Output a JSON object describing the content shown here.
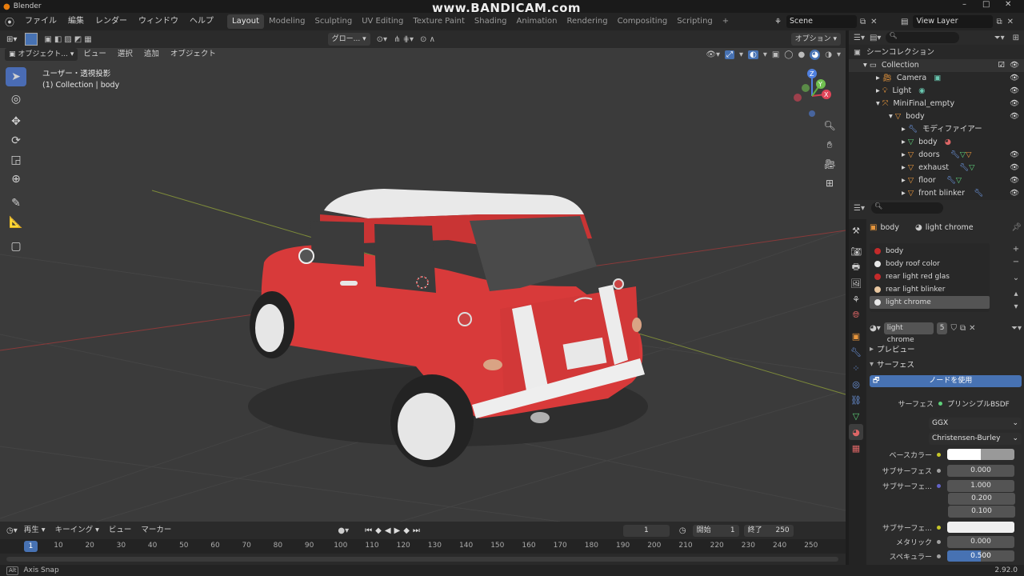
{
  "app_title": "Blender",
  "watermark": "www.BANDICAM.com",
  "menu": [
    "ファイル",
    "編集",
    "レンダー",
    "ウィンドウ",
    "ヘルプ"
  ],
  "workspaces": [
    "Layout",
    "Modeling",
    "Sculpting",
    "UV Editing",
    "Texture Paint",
    "Shading",
    "Animation",
    "Rendering",
    "Compositing",
    "Scripting"
  ],
  "active_workspace": "Layout",
  "scene": "Scene",
  "view_layer": "View Layer",
  "viewport": {
    "orientation": "グロー...",
    "options": "オプション",
    "mode": "オブジェクト...",
    "menus": [
      "ビュー",
      "選択",
      "追加",
      "オブジェクト"
    ],
    "info_line1": "ユーザー・透視投影",
    "info_line2": "(1) Collection | body"
  },
  "outliner": {
    "title": "シーンコレクション",
    "rows": [
      {
        "label": "Collection",
        "indent": 1
      },
      {
        "label": "Camera",
        "indent": 2
      },
      {
        "label": "Light",
        "indent": 2
      },
      {
        "label": "MiniFinal_empty",
        "indent": 2
      },
      {
        "label": "body",
        "indent": 3
      },
      {
        "label": "モディファイアー",
        "indent": 4
      },
      {
        "label": "body",
        "indent": 4
      },
      {
        "label": "doors",
        "indent": 4
      },
      {
        "label": "exhaust",
        "indent": 4
      },
      {
        "label": "floor",
        "indent": 4
      },
      {
        "label": "front blinker",
        "indent": 4
      }
    ]
  },
  "properties": {
    "breadcrumb_object": "body",
    "breadcrumb_material": "light chrome",
    "slots": [
      {
        "name": "body",
        "color": "#c42a2a"
      },
      {
        "name": "body roof color",
        "color": "#e8e8e8"
      },
      {
        "name": "rear light red glas",
        "color": "#c42a2a"
      },
      {
        "name": "rear light blinker",
        "color": "#e8c7a0"
      },
      {
        "name": "light chrome",
        "color": "#e8e8e8"
      }
    ],
    "active_slot": 4,
    "material_name": "light chrome",
    "user_count": "5",
    "preview_label": "プレビュー",
    "surface_label": "サーフェス",
    "use_nodes": "ノードを使用",
    "surface_row_label": "サーフェス",
    "shader": "プリンシプルBSDF",
    "distribution": "GGX",
    "subsurface_method": "Christensen-Burley",
    "base_color_label": "ベースカラー",
    "subsurface_label": "サブサーフェス",
    "subsurface_value": "0.000",
    "subsurface_radius_label": "サブサーフェ...",
    "radius": [
      "1.000",
      "0.200",
      "0.100"
    ],
    "subsurface_color_label": "サブサーフェ...",
    "metallic_label": "メタリック",
    "metallic_value": "0.000",
    "specular_label": "スペキュラー",
    "specular_value": "0.500",
    "specular_fraction": 0.5
  },
  "timeline": {
    "menus": [
      "再生",
      "キーイング",
      "ビュー",
      "マーカー"
    ],
    "current_frame": "1",
    "start_label": "開始",
    "start": "1",
    "end_label": "終了",
    "end": "250",
    "ticks": [
      "10",
      "20",
      "30",
      "40",
      "50",
      "60",
      "70",
      "80",
      "90",
      "100",
      "110",
      "120",
      "130",
      "140",
      "150",
      "160",
      "170",
      "180",
      "190",
      "200",
      "210",
      "220",
      "230",
      "240",
      "250"
    ],
    "playhead": "1"
  },
  "status": {
    "left": "Axis Snap",
    "version": "2.92.0"
  },
  "colors": {
    "accent": "#4772b3",
    "car_body": "#d83a3a",
    "car_roof": "#e9e9e9",
    "viewport_bg": "#3b3b3b"
  }
}
